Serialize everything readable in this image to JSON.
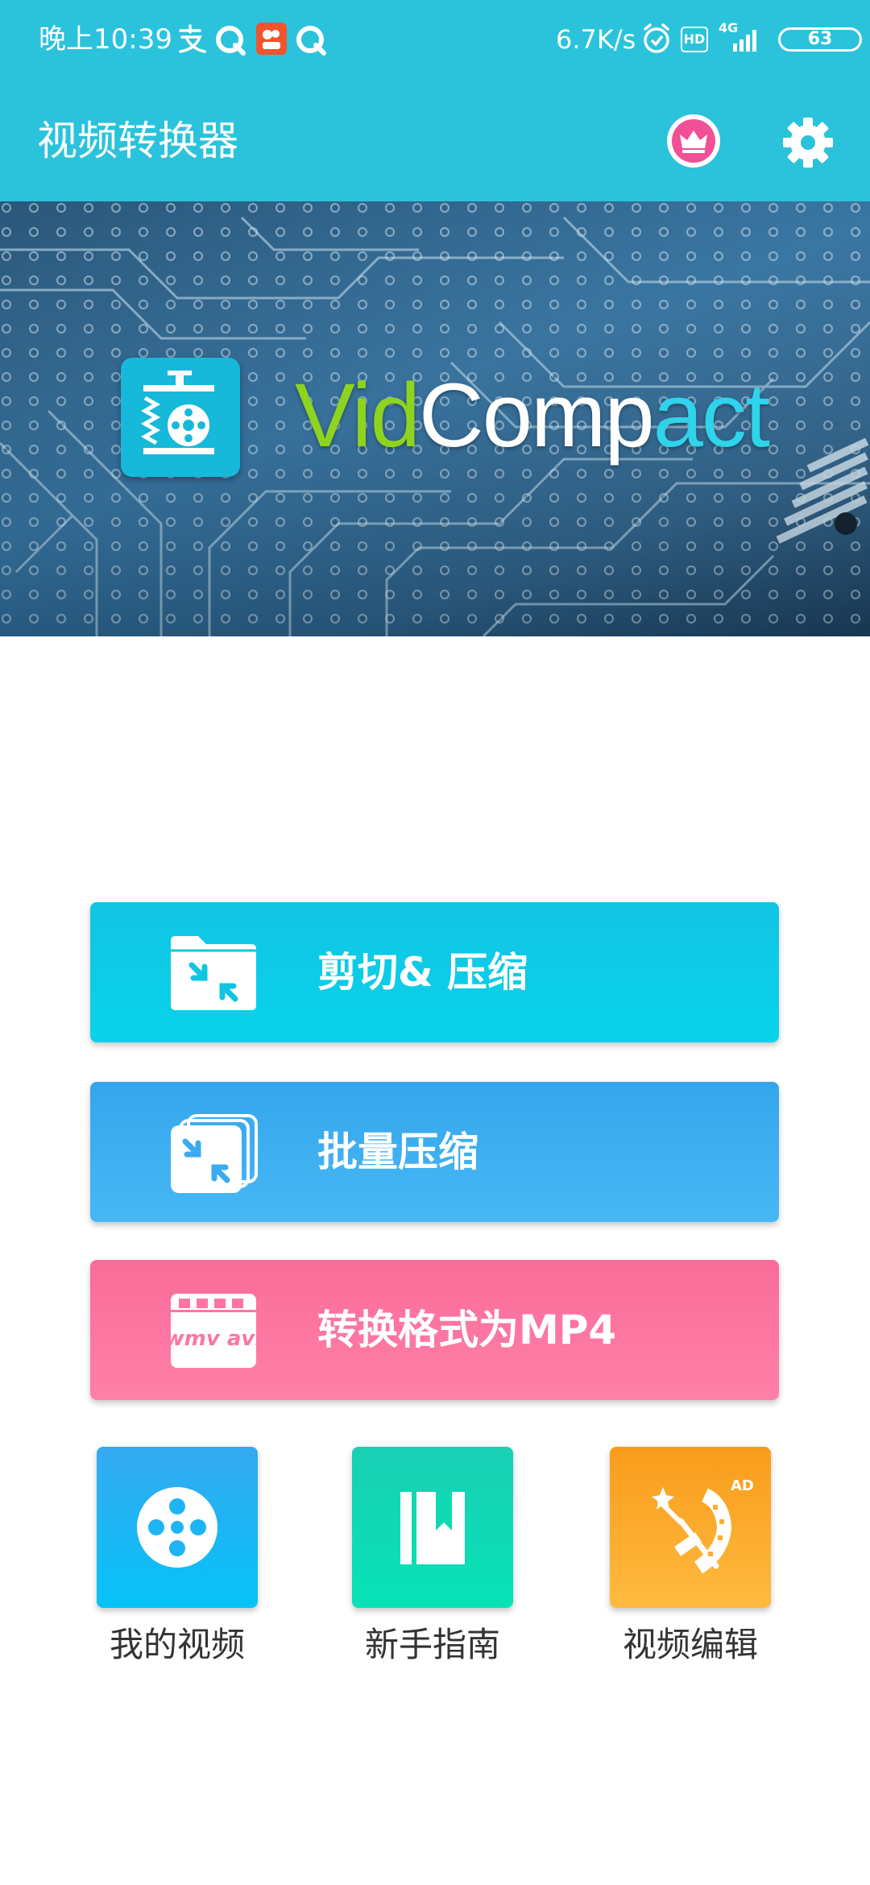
{
  "status_bar": {
    "time": "晚上10:39",
    "net_speed": "6.7K/s",
    "hd_badge": "HD",
    "network": "4G",
    "battery": "63"
  },
  "app_bar": {
    "title": "视频转换器",
    "icons": [
      "crown-icon",
      "gear-icon"
    ]
  },
  "banner": {
    "logo_text_1": "Vid",
    "logo_text_2": "Comp",
    "logo_text_3": "act"
  },
  "actions": [
    {
      "label": "剪切& 压缩",
      "icon": "folder-compress-icon",
      "color": "#08cde6"
    },
    {
      "label": "批量压缩",
      "icon": "stack-compress-icon",
      "color": "#3eb0f0"
    },
    {
      "label": "转换格式为MP4",
      "icon": "clapper-format-icon",
      "badge_text": "wmv avi",
      "color": "#fc76a2"
    }
  ],
  "tiles": [
    {
      "label": "我的视频",
      "icon": "film-reel-icon"
    },
    {
      "label": "新手指南",
      "icon": "book-icon"
    },
    {
      "label": "视频编辑",
      "icon": "magic-wand-film-icon",
      "badge": "AD"
    }
  ]
}
